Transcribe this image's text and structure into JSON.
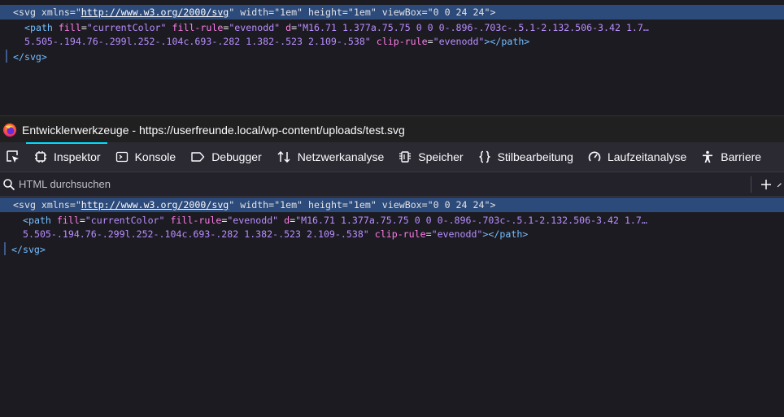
{
  "markup": {
    "svg_open": {
      "lt": "<",
      "tag": "svg",
      "xmlns_attr": "xmlns",
      "xmlns_val": "http://www.w3.org/2000/svg",
      "width_attr": "width",
      "width_val": "\"1em\"",
      "height_attr": "height",
      "height_val": "\"1em\"",
      "viewbox_attr": "viewBox",
      "viewbox_val": "\"0 0 24 24\"",
      "gt": ">"
    },
    "path_line1": {
      "lt": "<",
      "tag": "path",
      "fill_attr": "fill",
      "fill_val": "\"currentColor\"",
      "fillrule_attr": "fill-rule",
      "fillrule_val": "\"evenodd\"",
      "d_attr": "d",
      "d_val_start": "\"M16.71 1.377a.75.75 0 0 0-.896-.703c-.5.1-2.132.506-3.42 1.7…"
    },
    "path_line2": {
      "d_val_end": "5.505-.194.76-.299l.252-.104c.693-.282 1.382-.523 2.109-.538\"",
      "cliprule_attr": "clip-rule",
      "cliprule_val": "\"evenodd\"",
      "close": "></",
      "close_tag": "path",
      "gt": ">"
    },
    "svg_close": {
      "open": "</",
      "tag": "svg",
      "gt": ">"
    },
    "eq": "=",
    "url_quote": "\""
  },
  "window": {
    "title": "Entwicklerwerkzeuge - https://userfreunde.local/wp-content/uploads/test.svg"
  },
  "toolbar": {
    "tabs": [
      {
        "label": "Inspektor",
        "icon": "inspector-icon",
        "active": true
      },
      {
        "label": "Konsole",
        "icon": "console-icon"
      },
      {
        "label": "Debugger",
        "icon": "debugger-icon"
      },
      {
        "label": "Netzwerkanalyse",
        "icon": "network-icon"
      },
      {
        "label": "Speicher",
        "icon": "memory-icon"
      },
      {
        "label": "Stilbearbeitung",
        "icon": "style-editor-icon"
      },
      {
        "label": "Laufzeitanalyse",
        "icon": "performance-icon"
      },
      {
        "label": "Barriere",
        "icon": "accessibility-icon"
      }
    ]
  },
  "search": {
    "placeholder": "HTML durchsuchen"
  },
  "colors": {
    "accent": "#00ddff",
    "selection": "#2c4a7a",
    "tag": "#75bfff",
    "attribute": "#ff7de9",
    "value": "#b98eff"
  }
}
